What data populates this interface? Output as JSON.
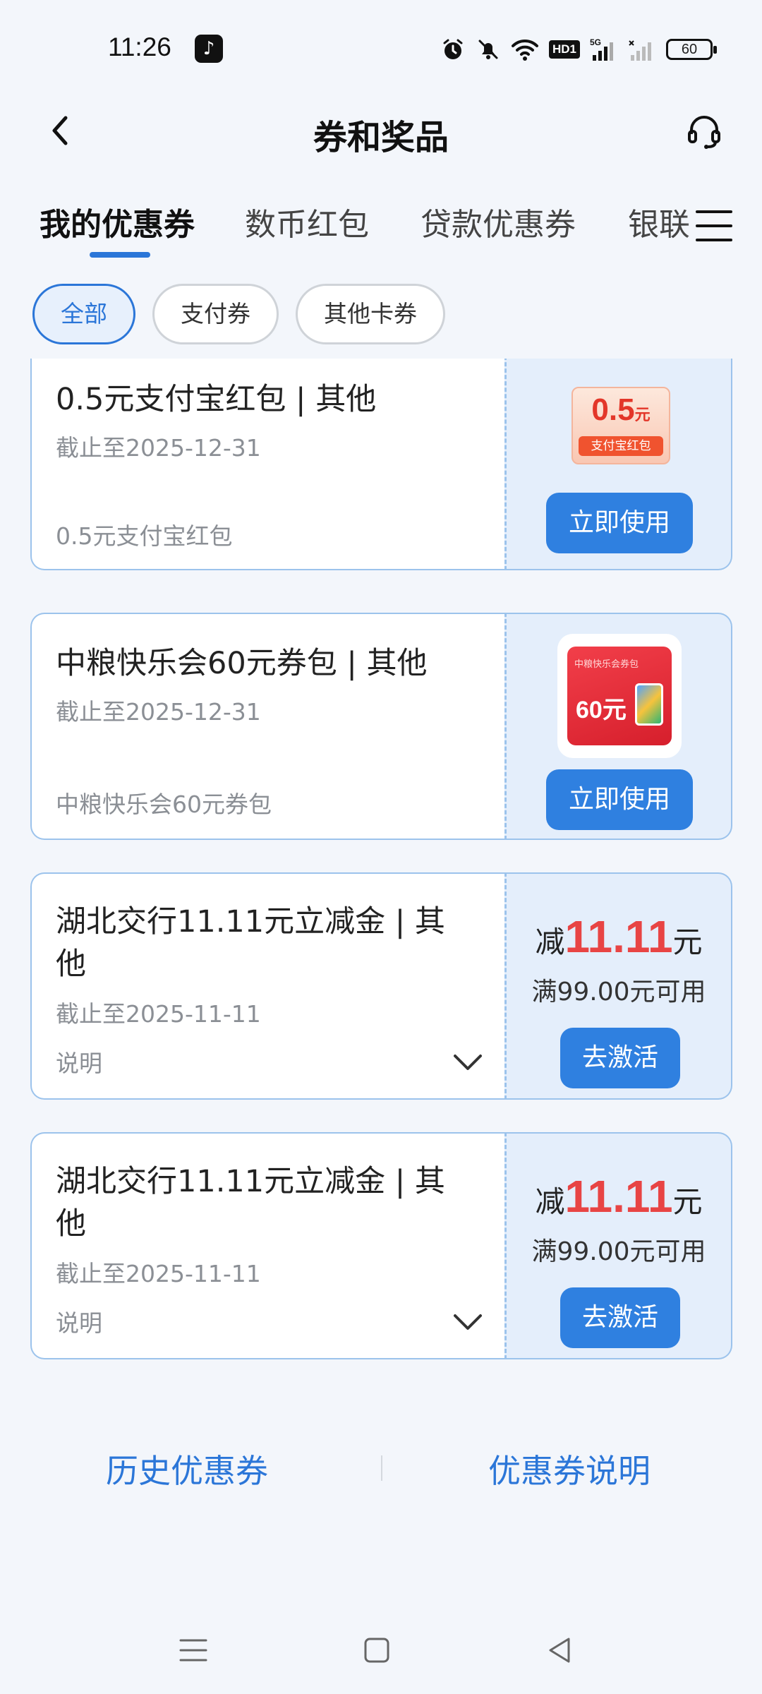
{
  "status_bar": {
    "time": "11:26",
    "app_icon": "tiktok-icon",
    "network": "5G",
    "hd_label": "HD1",
    "battery": "60"
  },
  "header": {
    "title": "券和奖品",
    "back_icon": "chevron-left-icon",
    "service_icon": "headset-icon"
  },
  "tabs": [
    {
      "label": "我的优惠券",
      "active": true
    },
    {
      "label": "数币红包",
      "active": false
    },
    {
      "label": "贷款优惠券",
      "active": false
    },
    {
      "label": "银联",
      "active": false
    }
  ],
  "filters": [
    {
      "label": "全部",
      "active": true
    },
    {
      "label": "支付券",
      "active": false
    },
    {
      "label": "其他卡券",
      "active": false
    }
  ],
  "coupons": [
    {
      "title": "0.5元支付宝红包 | 其他",
      "expiry": "截止至2025-12-31",
      "description": "0.5元支付宝红包",
      "thumb_amount": "0.5",
      "thumb_unit": "元",
      "thumb_label": "支付宝红包",
      "action": "立即使用"
    },
    {
      "title": "中粮快乐会60元券包 | 其他",
      "expiry": "截止至2025-12-31",
      "description": "中粮快乐会60元券包",
      "thumb_small": "中粮快乐会券包",
      "thumb_big": "60元",
      "action": "立即使用"
    },
    {
      "title": "湖北交行11.11元立减金 | 其他",
      "expiry": "截止至2025-11-11",
      "description": "说明",
      "discount_prefix": "减",
      "discount_value": "11.11",
      "discount_unit": "元",
      "condition": "满99.00元可用",
      "action": "去激活"
    },
    {
      "title": "湖北交行11.11元立减金 | 其他",
      "expiry": "截止至2025-11-11",
      "description": "说明",
      "discount_prefix": "减",
      "discount_value": "11.11",
      "discount_unit": "元",
      "condition": "满99.00元可用",
      "action": "去激活"
    }
  ],
  "footer": {
    "history_link": "历史优惠券",
    "help_link": "优惠券说明"
  },
  "colors": {
    "accent": "#2b76d8",
    "button": "#2f80e0",
    "discount_red": "#e84444",
    "coupon_border": "#9cc3ec",
    "coupon_right_bg": "#e4eefb"
  }
}
